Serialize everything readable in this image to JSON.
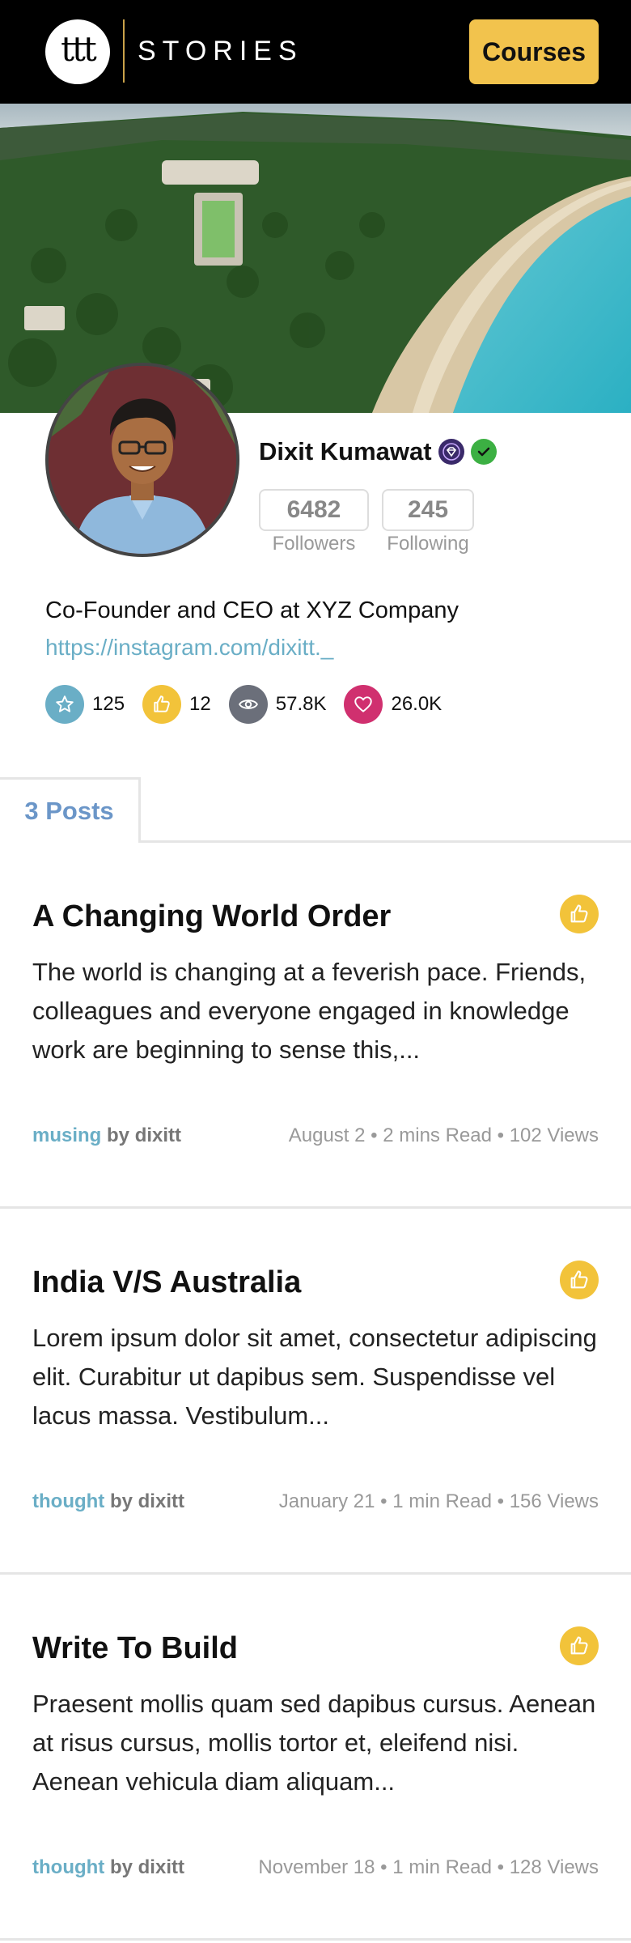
{
  "header": {
    "logo_text": "ttt",
    "brand": "STORIES",
    "courses_label": "Courses"
  },
  "profile": {
    "name": "Dixit Kumawat",
    "followers_count": "6482",
    "followers_label": "Followers",
    "following_count": "245",
    "following_label": "Following",
    "bio": "Co-Founder and CEO at XYZ Company",
    "link": "https://instagram.com/dixitt._",
    "metrics": {
      "stars": "125",
      "likes": "12",
      "views": "57.8K",
      "hearts": "26.0K"
    }
  },
  "tabs": {
    "posts_label": "3 Posts"
  },
  "posts": [
    {
      "title": "A Changing World Order",
      "excerpt": "The world is changing at a feverish pace. Friends, colleagues and everyone engaged in knowledge work are beginning to sense this,...",
      "tag": "musing",
      "by": "by dixitt",
      "meta": "August 2 • 2 mins Read • 102 Views"
    },
    {
      "title": "India V/S Australia",
      "excerpt": "Lorem ipsum dolor sit amet, consectetur adipiscing elit. Curabitur ut dapibus sem. Suspendisse vel lacus massa. Vestibulum...",
      "tag": "thought",
      "by": "by dixitt",
      "meta": "January 21 • 1 min Read • 156 Views"
    },
    {
      "title": "Write To Build",
      "excerpt": "Praesent mollis quam sed dapibus cursus. Aenean at risus cursus, mollis tortor et, eleifend nisi. Aenean vehicula diam aliquam...",
      "tag": "thought",
      "by": "by dixitt",
      "meta": "November 18 • 1 min Read • 128 Views"
    }
  ],
  "colors": {
    "accent_yellow": "#f2c34d",
    "link_blue": "#6aaec6",
    "tab_blue": "#6b96c8",
    "star_blue": "#6aaec6",
    "views_gray": "#6b6f7a",
    "heart_pink": "#d0306f"
  },
  "icons": {
    "premium": "gem-badge-icon",
    "verified": "check-badge-icon",
    "star": "star-icon",
    "like": "thumbs-up-icon",
    "views": "eye-icon",
    "heart": "heart-icon"
  }
}
